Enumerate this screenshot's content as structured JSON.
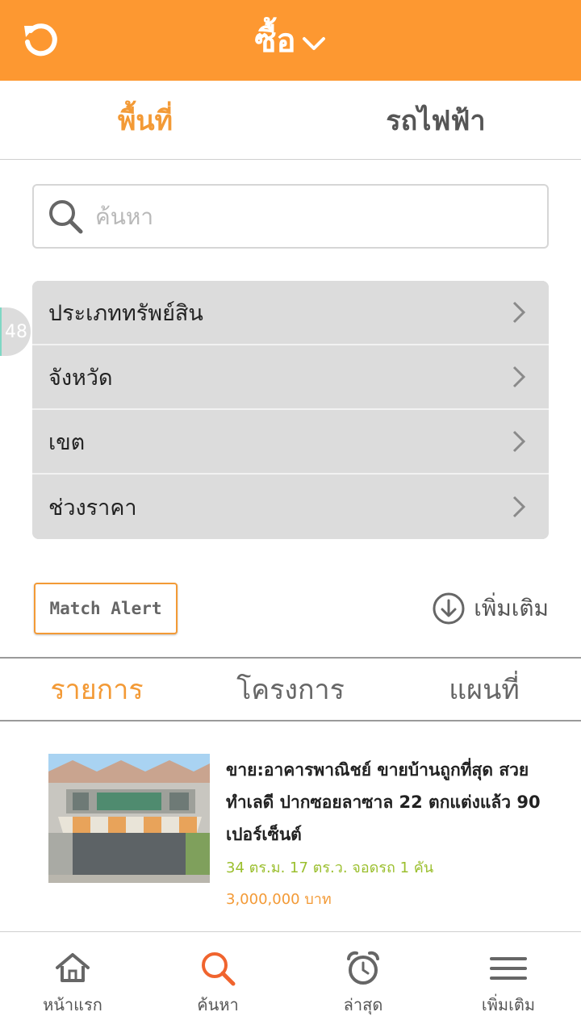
{
  "header": {
    "title": "ซื้อ",
    "accent_color": "#FD9831",
    "refresh_icon": "refresh-icon",
    "dropdown_icon": "chevron-down-icon"
  },
  "location_tabs": [
    {
      "label": "พื้นที่",
      "active": true
    },
    {
      "label": "รถไฟฟ้า",
      "active": false
    }
  ],
  "search": {
    "placeholder": "ค้นหา",
    "icon": "search-icon"
  },
  "side_badge": "48",
  "filters": [
    {
      "label": "ประเภททรัพย์สิน"
    },
    {
      "label": "จังหวัด"
    },
    {
      "label": "เขต"
    },
    {
      "label": "ช่วงราคา"
    }
  ],
  "match_alert": {
    "label": "Match Alert"
  },
  "more": {
    "label": "เพิ่มเติม",
    "icon": "download-circle-icon"
  },
  "result_tabs": [
    {
      "label": "รายการ",
      "active": true
    },
    {
      "label": "โครงการ",
      "active": false
    },
    {
      "label": "แผนที่",
      "active": false
    }
  ],
  "listings": [
    {
      "title": "ขาย:อาคารพาณิชย์ ขายบ้านถูกที่สุด สวย ทำเลดี ปากซอยลาซาล 22 ตกแต่งแล้ว 90 เปอร์เซ็นต์",
      "spec": "34 ตร.ม. 17 ตร.ว. จอดรถ 1 คัน",
      "price": "3,000,000 บาท",
      "spec_color": "#9BBF2E",
      "price_color": "#F39A36"
    }
  ],
  "bottom_nav": [
    {
      "label": "หน้าแรก",
      "icon": "home-icon",
      "active": false
    },
    {
      "label": "ค้นหา",
      "icon": "search-icon",
      "active": true
    },
    {
      "label": "ล่าสุด",
      "icon": "alarm-clock-icon",
      "active": false
    },
    {
      "label": "เพิ่มเติม",
      "icon": "menu-icon",
      "active": false
    }
  ]
}
